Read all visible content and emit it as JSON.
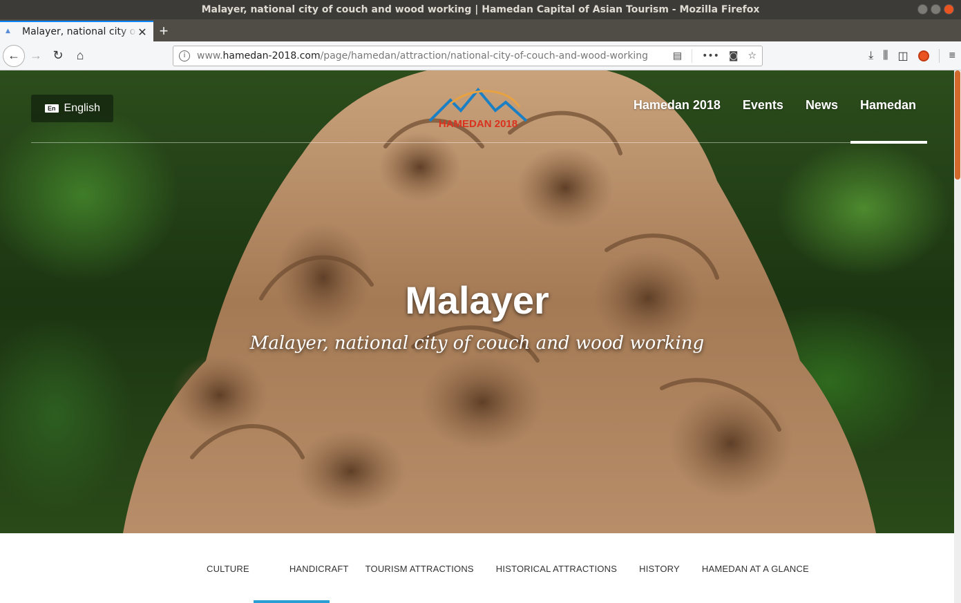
{
  "window": {
    "title": "Malayer, national city of couch and wood working | Hamedan Capital of Asian Tourism - Mozilla Firefox"
  },
  "tab": {
    "title": "Malayer, national city of couch and wood working",
    "close": "✕",
    "new_tab": "+"
  },
  "toolbar": {
    "back_icon": "←",
    "forward_icon": "→",
    "reload_icon": "↻",
    "home_icon": "⌂",
    "info_icon": "i",
    "url_prefix": "www.",
    "url_host": "hamedan-2018.com",
    "url_path": "/page/hamedan/attraction/national-city-of-couch-and-wood-working",
    "reader_icon": "▤",
    "more_icon": "•••",
    "pocket_icon": "◙",
    "bookmark_icon": "☆",
    "download_icon": "⤓",
    "library_icon": "⫼",
    "sidebar_icon": "◫",
    "menu_icon": "≡"
  },
  "site": {
    "lang_flag": "En",
    "lang_label": "English",
    "logo_text": "HAMEDAN 2018",
    "nav": [
      "Hamedan 2018",
      "Events",
      "News",
      "Hamedan"
    ],
    "active_nav": "Hamedan",
    "hero_title": "Malayer",
    "hero_subtitle": "Malayer, national city of couch and wood working",
    "subnav": [
      "CULTURE",
      "HANDICRAFT",
      "TOURISM ATTRACTIONS",
      "HISTORICAL ATTRACTIONS",
      "HISTORY",
      "HAMEDAN AT A GLANCE"
    ],
    "active_subnav": "HANDICRAFT"
  },
  "colors": {
    "accent_subnav": "#2a9fd6",
    "titlebar": "#3c3b37",
    "close_button": "#e95420"
  }
}
